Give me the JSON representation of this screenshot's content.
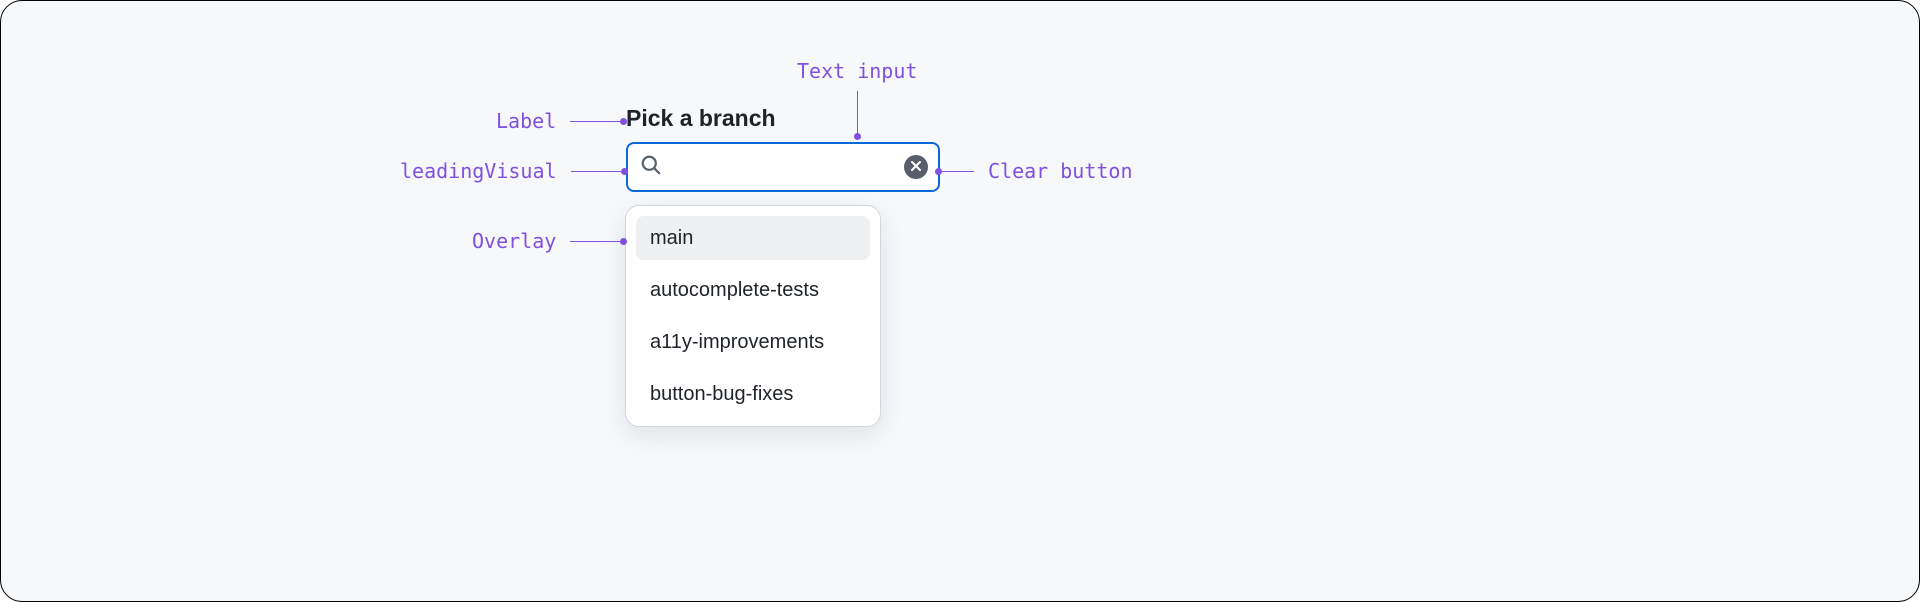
{
  "label": "Pick a branch",
  "input": {
    "value": "",
    "placeholder": ""
  },
  "overlay": {
    "items": [
      {
        "label": "main",
        "selected": true
      },
      {
        "label": "autocomplete-tests",
        "selected": false
      },
      {
        "label": "a11y-improvements",
        "selected": false
      },
      {
        "label": "button-bug-fixes",
        "selected": false
      }
    ]
  },
  "annotations": {
    "label": "Label",
    "leadingVisual": "leadingVisual",
    "overlay": "Overlay",
    "textInput": "Text input",
    "clearButton": "Clear button"
  },
  "colors": {
    "accent": "#0969da",
    "annotation": "#8250df",
    "surface": "#f6f8fa",
    "muted": "#57606a"
  }
}
